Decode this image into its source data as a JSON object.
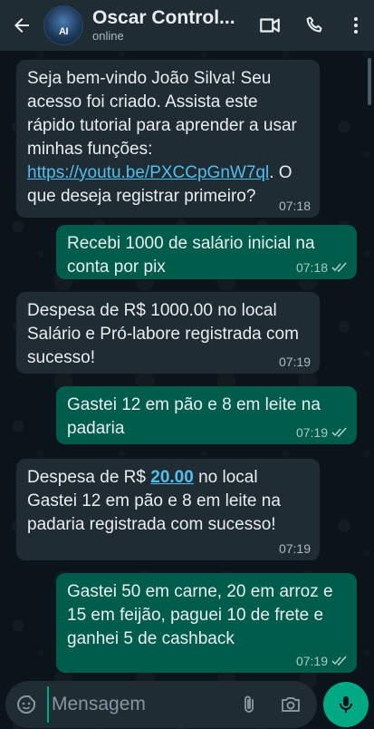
{
  "header": {
    "contact_name": "Oscar Control...",
    "status": "online",
    "avatar_text": "AI"
  },
  "messages": [
    {
      "direction": "in",
      "segments": [
        {
          "text": "Seja bem-vindo João Silva! Seu acesso foi criado. Assista este rápido tutorial para aprender a usar minhas funções: "
        },
        {
          "text": "https://youtu.be/PXCCpGnW7ql",
          "link": true
        },
        {
          "text": ". O que deseja registrar primeiro?"
        }
      ],
      "time": "07:18"
    },
    {
      "direction": "out",
      "text": "Recebi 1000 de salário inicial na conta por pix",
      "time": "07:18"
    },
    {
      "direction": "in",
      "text": "Despesa de R$ 1000.00 no local Salário e Pró-labore registrada com sucesso!",
      "time": "07:19"
    },
    {
      "direction": "out",
      "text": "Gastei 12 em pão e 8 em leite na padaria",
      "time": "07:19"
    },
    {
      "direction": "in",
      "segments": [
        {
          "text": "Despesa de R$ "
        },
        {
          "text": "20.00",
          "link": true
        },
        {
          "text": " no local Gastei 12 em pão e 8 em leite na padaria registrada com sucesso!"
        }
      ],
      "time": "07:19"
    },
    {
      "direction": "out",
      "text": "Gastei 50 em carne, 20 em arroz e 15 em feijão, paguei 10 de frete e ganhei 5 de cashback",
      "time": "07:19"
    }
  ],
  "composer": {
    "placeholder": "Mensagem"
  },
  "icons": {
    "back": "arrow-left-icon",
    "video": "video-camera-icon",
    "call": "phone-icon",
    "menu": "more-vertical-icon",
    "emoji": "sticker-icon",
    "attach": "paperclip-icon",
    "camera": "camera-icon",
    "mic": "microphone-icon",
    "read": "double-check-icon"
  },
  "colors": {
    "header_bg": "#1f2c34",
    "incoming_bubble": "#1f2c34",
    "outgoing_bubble": "#005c4b",
    "accent": "#00a884",
    "link": "#53bdeb"
  }
}
